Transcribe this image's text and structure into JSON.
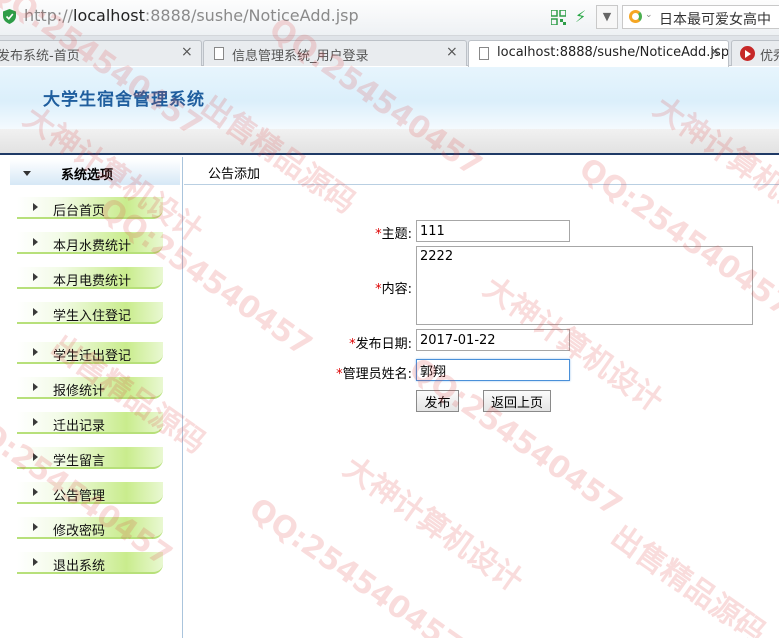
{
  "browser": {
    "url_scheme": "http://",
    "url_host": "localhost",
    "url_path": ":8888/sushe/NoticeAdd.jsp",
    "search_text": "日本最可爱女高中",
    "tabs": [
      {
        "label": "发布系统-首页",
        "close": "×"
      },
      {
        "label": "信息管理系统_用户登录",
        "close": "×"
      },
      {
        "label": "localhost:8888/sushe/NoticeAdd.jsp",
        "close": "×"
      },
      {
        "label": "优秀"
      }
    ]
  },
  "app": {
    "title": "大学生宿舍管理系统"
  },
  "sidebar": {
    "header": "系统选项",
    "items": [
      {
        "label": "后台首页"
      },
      {
        "label": "本月水费统计"
      },
      {
        "label": "本月电费统计"
      },
      {
        "label": "学生入住登记"
      },
      {
        "label": "学生迁出登记"
      },
      {
        "label": "报修统计"
      },
      {
        "label": "迁出记录"
      },
      {
        "label": "学生留言"
      },
      {
        "label": "公告管理"
      },
      {
        "label": "修改密码"
      },
      {
        "label": "退出系统"
      }
    ]
  },
  "main": {
    "breadcrumb": "公告添加",
    "form": {
      "required_mark": "*",
      "subject_label": "主题:",
      "subject_value": "111",
      "content_label": "内容:",
      "content_value": "2222",
      "date_label": "发布日期:",
      "date_value": "2017-01-22",
      "admin_label": "管理员姓名:",
      "admin_value": "郭翔",
      "submit_label": "发布",
      "back_label": "返回上页"
    }
  },
  "watermark": {
    "texts": [
      "QQ:254540457",
      "大神计算机设计",
      "出售精品源码"
    ],
    "color": "#dc3c3c"
  }
}
